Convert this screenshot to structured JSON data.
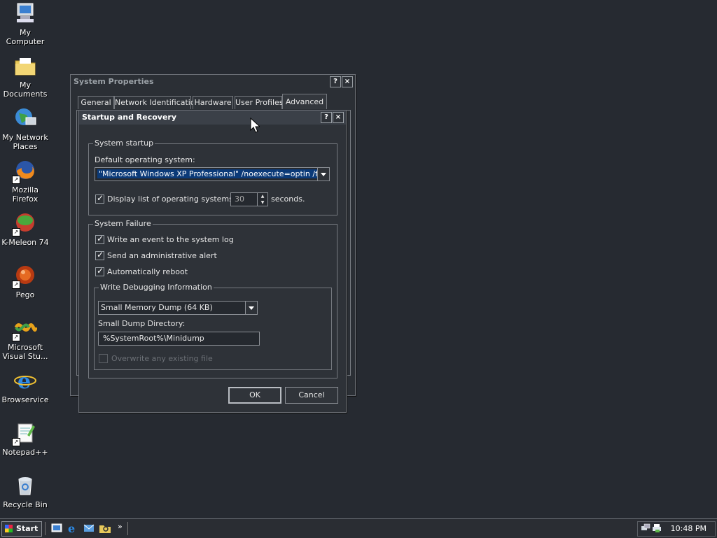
{
  "desktop_icons": [
    {
      "label": "My Computer",
      "icon": "my-computer-icon"
    },
    {
      "label": "My Documents",
      "icon": "my-documents-icon"
    },
    {
      "label": "My Network Places",
      "icon": "network-places-icon"
    },
    {
      "label": "Mozilla Firefox",
      "icon": "firefox-icon"
    },
    {
      "label": "K-Meleon 74",
      "icon": "kmeleon-icon"
    },
    {
      "label": "Pego",
      "icon": "pego-icon"
    },
    {
      "label": "Microsoft Visual Stu...",
      "icon": "visual-studio-icon"
    },
    {
      "label": "Browservice",
      "icon": "ie-icon"
    },
    {
      "label": "Notepad++",
      "icon": "notepadpp-icon"
    },
    {
      "label": "Recycle Bin",
      "icon": "recycle-bin-icon"
    }
  ],
  "system_properties": {
    "title": "System Properties",
    "help": "?",
    "close": "×",
    "tabs": [
      "General",
      "Network Identification",
      "Hardware",
      "User Profiles",
      "Advanced"
    ],
    "active_tab": "Advanced"
  },
  "startup_recovery": {
    "title": "Startup and Recovery",
    "help": "?",
    "close": "×",
    "system_startup": {
      "legend": "System startup",
      "default_os_label": "Default operating system:",
      "default_os_value": "\"Microsoft Windows XP Professional\" /noexecute=optin /fastdetect",
      "display_list_label": "Display list of operating systems for",
      "display_list_checked": true,
      "seconds_value": "30",
      "seconds_label": "seconds."
    },
    "system_failure": {
      "legend": "System Failure",
      "write_event": {
        "label": "Write an event to the system log",
        "checked": true
      },
      "send_alert": {
        "label": "Send an administrative alert",
        "checked": true
      },
      "auto_reboot": {
        "label": "Automatically reboot",
        "checked": true
      },
      "debug": {
        "legend": "Write Debugging Information",
        "dump_type": "Small Memory Dump (64 KB)",
        "dir_label": "Small Dump Directory:",
        "dir_value": "%SystemRoot%\\Minidump",
        "overwrite_label": "Overwrite any existing file",
        "overwrite_checked": false
      }
    },
    "ok": "OK",
    "cancel": "Cancel"
  },
  "taskbar": {
    "start": "Start",
    "more": "»",
    "clock": "10:48 PM"
  }
}
